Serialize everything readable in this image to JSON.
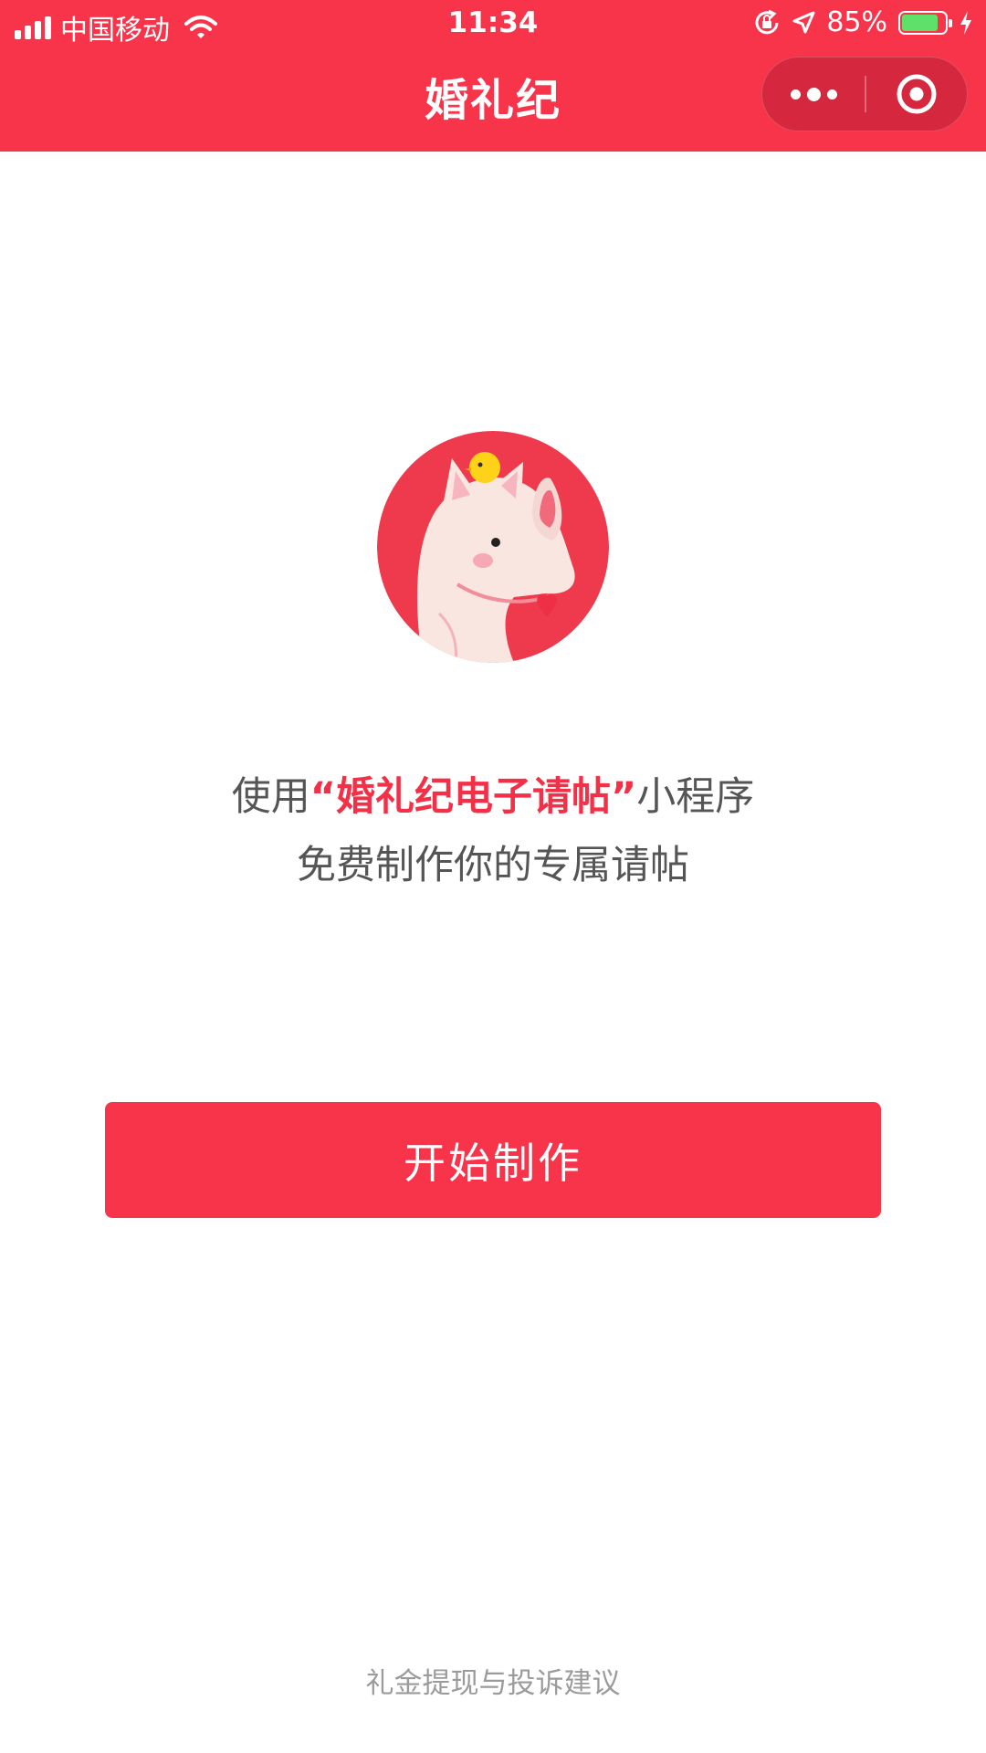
{
  "status_bar": {
    "carrier": "中国移动",
    "time": "11:34",
    "battery_percent_text": "85%",
    "battery_level": 0.85,
    "icons": [
      "signal-icon",
      "wifi-icon",
      "orientation-lock-icon",
      "location-arrow-icon",
      "battery-icon",
      "charging-bolt-icon"
    ]
  },
  "nav": {
    "title": "婚礼纪",
    "capsule": {
      "more_icon": "more-dots-icon",
      "close_icon": "close-target-icon"
    }
  },
  "hero": {
    "image": "rhino-mascot-avatar"
  },
  "promo": {
    "line1_prefix": "使用",
    "line1_highlight": "“婚礼纪电子请帖”",
    "line1_suffix": "小程序",
    "line2": "免费制作你的专属请帖"
  },
  "start_button": {
    "label": "开始制作"
  },
  "footer": {
    "link": "礼金提现与投诉建议"
  },
  "colors": {
    "brand": "#f8344b",
    "highlight": "#f23048",
    "text": "#555555",
    "footer_text": "#9b9b9b",
    "battery_green": "#5ee06a"
  }
}
